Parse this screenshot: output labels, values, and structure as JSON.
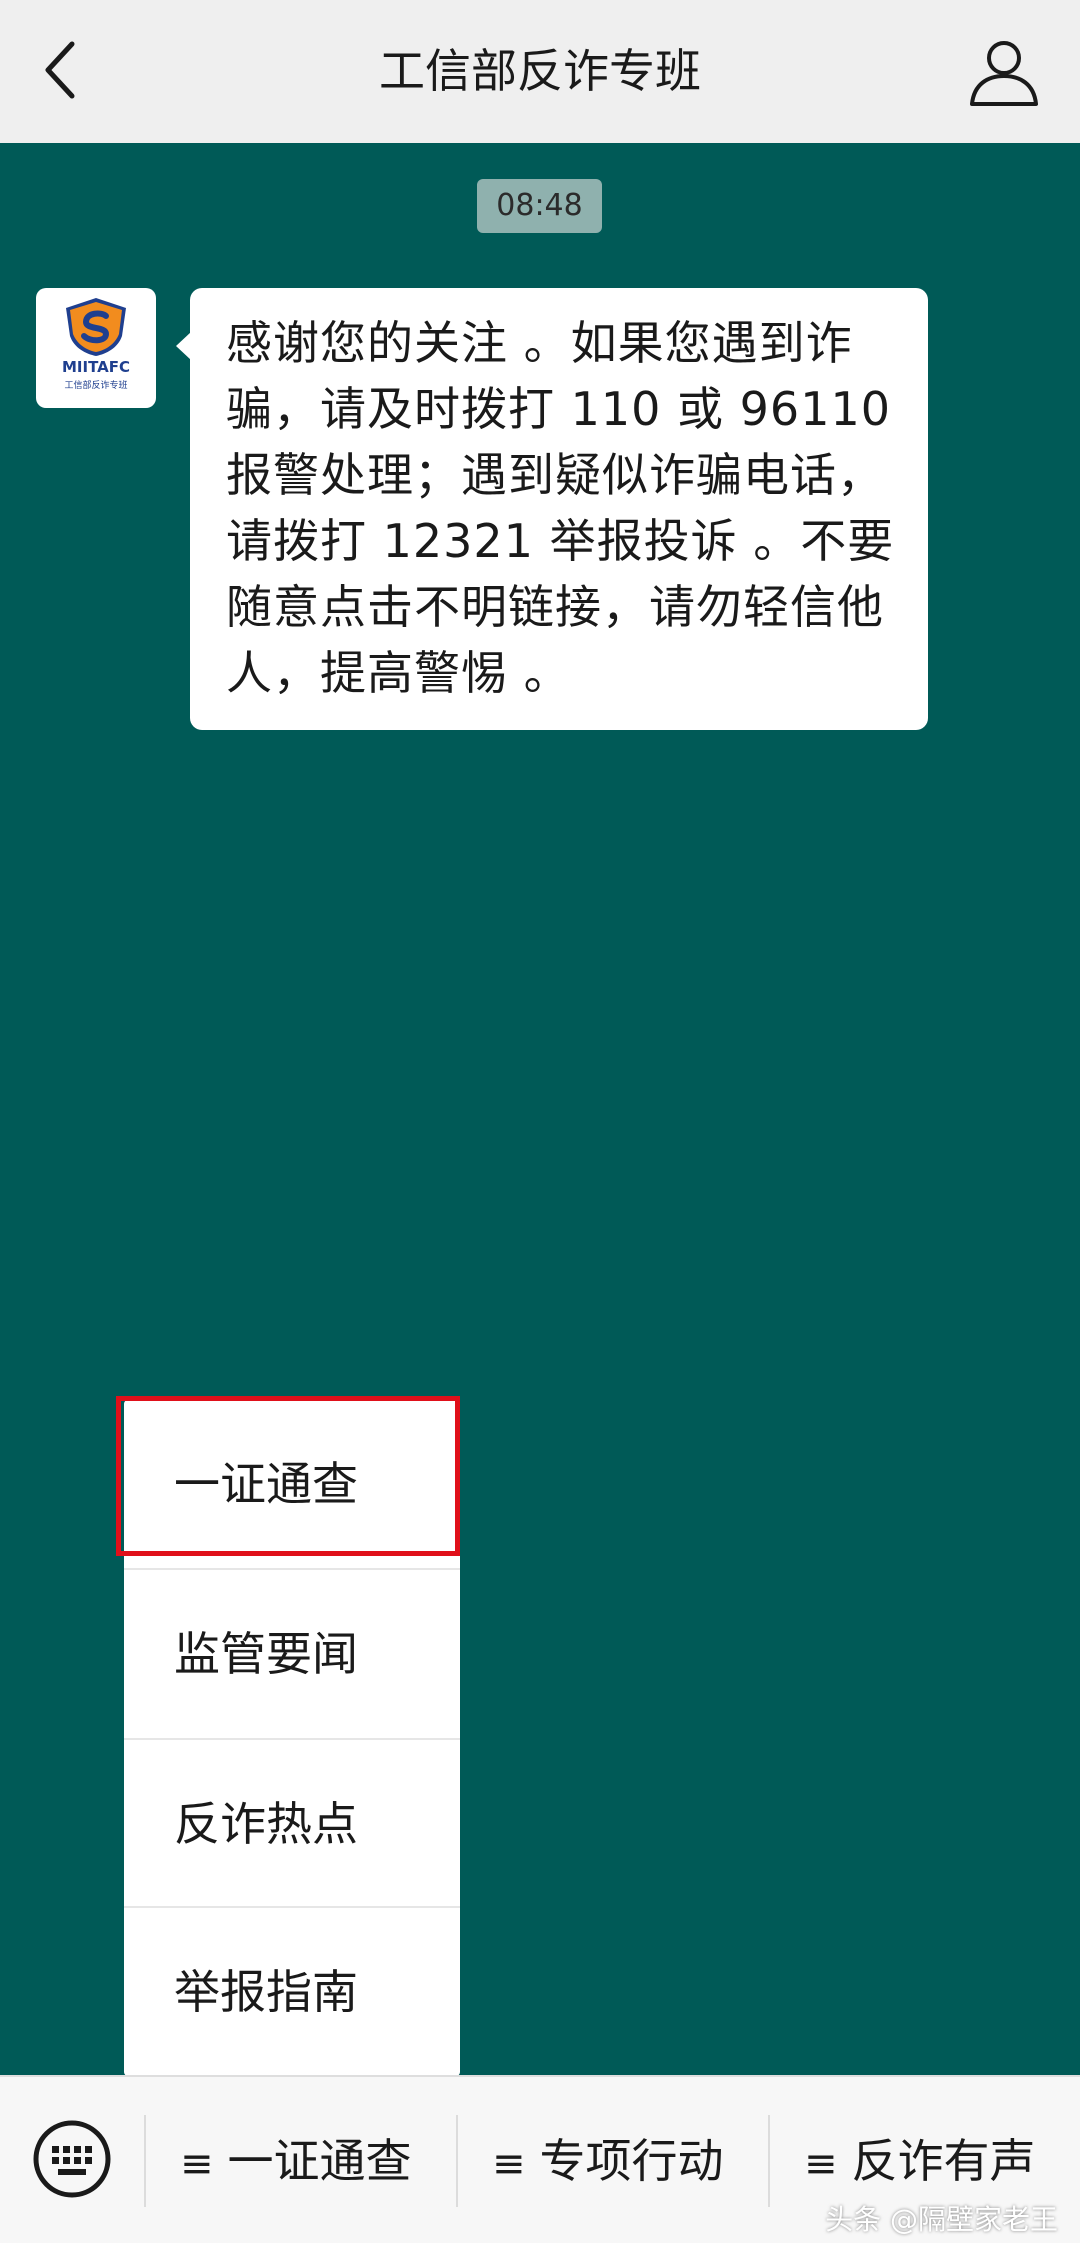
{
  "header": {
    "title": "工信部反诈专班",
    "back_icon": "chevron-left-icon",
    "profile_icon": "person-icon"
  },
  "chat": {
    "timestamp": "08:48",
    "avatar": {
      "logo_text": "MIITAFC",
      "logo_subtext": "工信部反诈专班"
    },
    "message": "感谢您的关注 。如果您遇到诈骗，请及时拨打 110 或 96110 报警处理；遇到疑似诈骗电话，请拨打 12321 举报投诉 。不要随意点击不明链接，请勿轻信他人，提高警惕 。"
  },
  "popup_menu": {
    "items": [
      {
        "label": "一证通查",
        "highlighted": true
      },
      {
        "label": "监管要闻"
      },
      {
        "label": "反诈热点"
      },
      {
        "label": "举报指南"
      }
    ]
  },
  "bottom_menu": {
    "keyboard_icon": "keyboard-icon",
    "menu_glyph": "≡",
    "buttons": [
      {
        "label": "一证通查"
      },
      {
        "label": "专项行动"
      },
      {
        "label": "反诈有声"
      }
    ]
  },
  "watermark": "头条 @隔壁家老王",
  "colors": {
    "chat_background": "#005a57",
    "header_background": "#efefef",
    "highlight": "#e0101a",
    "logo_orange": "#f28c1e",
    "logo_navy": "#1f3f8f"
  }
}
